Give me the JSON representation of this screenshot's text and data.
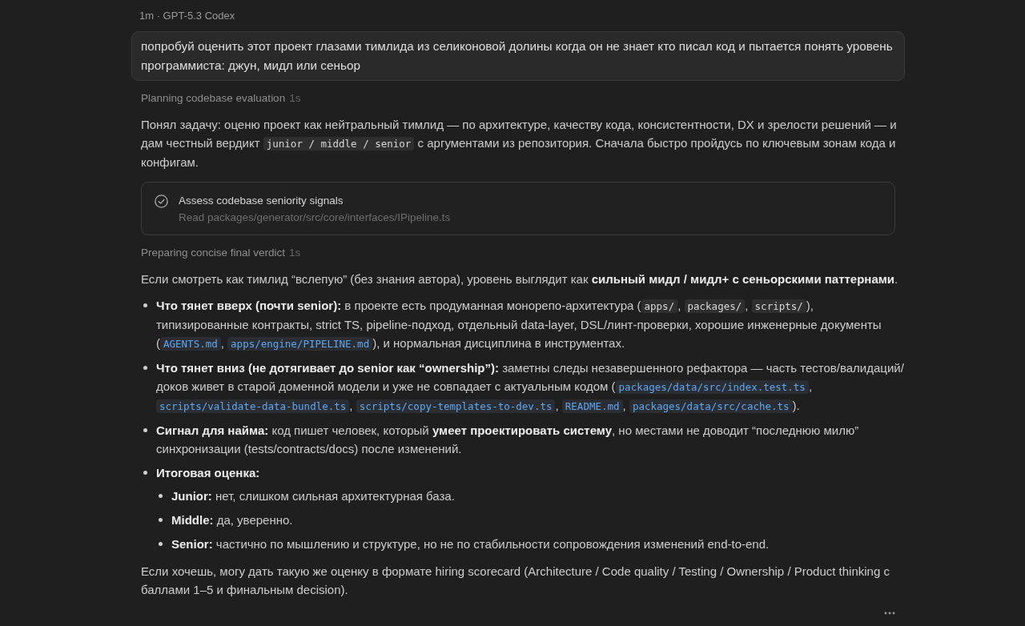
{
  "meta": "1m · GPT-5.3 Codex",
  "user_message": "попробуй оценить этот проект глазами тимлида из селиконовой долины когда он не знает кто писал код и пытается понять уровень программиста: джун, мидл или сеньор",
  "transcript": [
    {
      "kind": "status",
      "label": "Planning codebase evaluation",
      "duration": "1s"
    },
    {
      "kind": "paragraph",
      "parts": [
        {
          "kind": "text",
          "text": "Понял задачу: оценю проект как нейтральный тимлид — по архитектуре, качеству кода, консистентности, DX и зрелости решений — и дам честный вердикт "
        },
        {
          "kind": "code",
          "text": "junior / middle / senior"
        },
        {
          "kind": "text",
          "text": " с аргументами из репозитория. Сначала быстро пройдусь по ключевым зонам кода и конфигам."
        }
      ]
    },
    {
      "kind": "task",
      "title": "Assess codebase seniority signals",
      "detail": "Read packages/generator/src/core/interfaces/IPipeline.ts",
      "done": true
    },
    {
      "kind": "status",
      "label": "Preparing concise final verdict",
      "duration": "1s"
    },
    {
      "kind": "paragraph",
      "parts": [
        {
          "kind": "text",
          "text": "Если смотреть как тимлид “вслепую” (без знания автора), уровень выглядит как **сильный мидл / мидл+ с сеньорскими паттернами**."
        }
      ]
    },
    {
      "kind": "list",
      "items": [
        {
          "parts": [
            {
              "kind": "text",
              "text": "**Что тянет вверх (почти senior):** в проекте есть продуманная монорепо-архитектура ("
            },
            {
              "kind": "code",
              "text": "apps/"
            },
            {
              "kind": "text",
              "text": ", "
            },
            {
              "kind": "code",
              "text": "packages/"
            },
            {
              "kind": "text",
              "text": ", "
            },
            {
              "kind": "code",
              "text": "scripts/"
            },
            {
              "kind": "text",
              "text": "), типизированные контракты, strict TS, pipeline-подход, отдельный data-layer, DSL/линт-проверки, хорошие инженерные документы ("
            },
            {
              "kind": "file_link",
              "text": "AGENTS.md"
            },
            {
              "kind": "text",
              "text": ", "
            },
            {
              "kind": "file_link",
              "text": "apps/engine/PIPELINE.md"
            },
            {
              "kind": "text",
              "text": "), и нормальная дисциплина в инструментах."
            }
          ]
        },
        {
          "parts": [
            {
              "kind": "text",
              "text": "**Что тянет вниз (не дотягивает до senior как “ownership”):** заметны следы незавершенного рефактора — часть тестов/валидаций/доков живет в старой доменной модели и уже не совпадает с актуальным кодом ("
            },
            {
              "kind": "file_link",
              "text": "packages/data/src/index.test.ts"
            },
            {
              "kind": "text",
              "text": ", "
            },
            {
              "kind": "file_link",
              "text": "scripts/validate-data-bundle.ts"
            },
            {
              "kind": "text",
              "text": ", "
            },
            {
              "kind": "file_link",
              "text": "scripts/copy-templates-to-dev.ts"
            },
            {
              "kind": "text",
              "text": ", "
            },
            {
              "kind": "file_link",
              "text": "README.md"
            },
            {
              "kind": "text",
              "text": ", "
            },
            {
              "kind": "file_link",
              "text": "packages/data/src/cache.ts"
            },
            {
              "kind": "text",
              "text": ")."
            }
          ]
        },
        {
          "parts": [
            {
              "kind": "text",
              "text": "**Сигнал для найма:** код пишет человек, который **умеет проектировать систему**, но местами не доводит “последнюю милю” синхронизации (tests/contracts/docs) после изменений."
            }
          ]
        },
        {
          "parts": [
            {
              "kind": "text",
              "text": "**Итоговая оценка:**"
            }
          ],
          "children": [
            {
              "parts": [
                {
                  "kind": "text",
                  "text": "**Junior:** нет, слишком сильная архитектурная база."
                }
              ]
            },
            {
              "parts": [
                {
                  "kind": "text",
                  "text": "**Middle:** да, уверенно."
                }
              ]
            },
            {
              "parts": [
                {
                  "kind": "text",
                  "text": "**Senior:** частично по мышлению и структуре, но не по стабильности сопровождения изменений end-to-end."
                }
              ]
            }
          ]
        }
      ]
    },
    {
      "kind": "paragraph",
      "parts": [
        {
          "kind": "text",
          "text": "Если хочешь, могу дать такую же оценку в формате hiring scorecard (Architecture / Code quality / Testing / Ownership / Product thinking с баллами 1–5 и финальным decision)."
        }
      ]
    }
  ]
}
